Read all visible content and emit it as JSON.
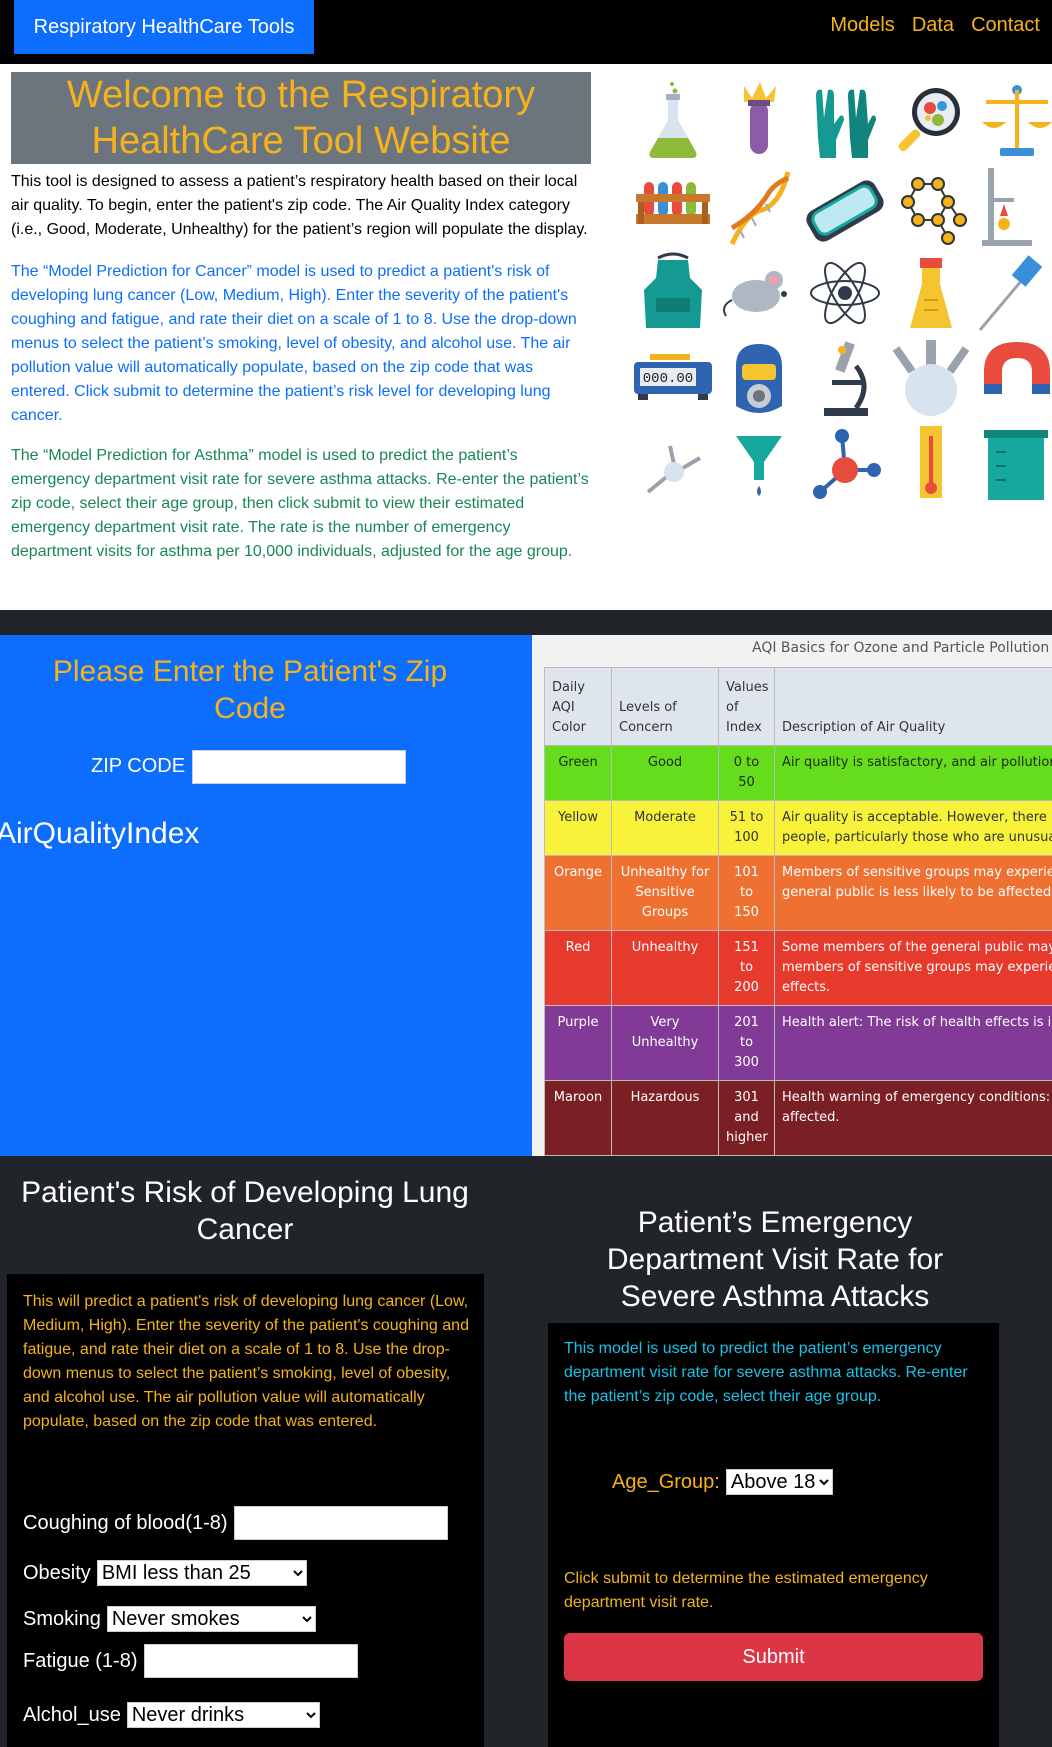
{
  "navbar": {
    "brand": "Respiratory HealthCare Tools",
    "links": [
      "Models",
      "Data",
      "Contact"
    ]
  },
  "intro": {
    "title": "Welcome to the Respiratory HealthCare Tool Website",
    "p1": "This tool is designed to assess a patient’s respiratory health based on their local air quality. To begin, enter the patient's zip code. The Air Quality Index category (i.e., Good, Moderate, Unhealthy) for the patient’s region will populate the display.",
    "p2": "The “Model Prediction for Cancer” model is used to predict a patient's risk of developing lung cancer (Low, Medium, High). Enter the severity of the patient's coughing and fatigue, and rate their diet on a scale of 1 to 8. Use the drop-down menus to select the patient’s smoking, level of obesity, and alcohol use. The air pollution value will automatically populate, based on the zip code that was entered. Click submit to determine the patient’s risk level for developing lung cancer.",
    "p3": "The “Model Prediction for Asthma” model is used to predict the patient’s emergency department visit rate for severe asthma attacks. Re-enter the patient’s zip code, select their age group, then click submit to view their estimated emergency department visit rate. The rate is the number of emergency department visits for asthma per 10,000 individuals, adjusted for the age group.",
    "icons": [
      "flask-icon",
      "test-tube-icon",
      "gloves-icon",
      "magnifier-icon",
      "scale-icon",
      "test-tube-rack-icon",
      "dna-icon",
      "goggles-icon",
      "molecule-ring-icon",
      "lab-stand-icon",
      "apron-icon",
      "mouse-icon",
      "atom-icon",
      "beaker-icon",
      "pipette-icon",
      "digital-scale-icon",
      "hazmat-mask-icon",
      "microscope-icon",
      "round-flask-icon",
      "magnet-icon",
      "dropper-icon",
      "funnel-icon",
      "molecule-icon",
      "thermometer-icon",
      "measuring-cup-icon"
    ]
  },
  "zip": {
    "title": "Please Enter the Patient's Zip Code",
    "label": "ZIP CODE",
    "value": "",
    "aqi_label": "AirQualityIndex"
  },
  "aqi_table": {
    "caption": "AQI Basics for Ozone and Particle Pollution",
    "headers": [
      "Daily AQI Color",
      "Levels of Concern",
      "Values of Index",
      "Description of Air Quality"
    ],
    "rows": [
      {
        "color": "Green",
        "level": "Good",
        "values": "0 to 50",
        "desc": "Air quality is satisfactory, and air pollution",
        "bg": "#66dd1c",
        "fg": "#1f2b10"
      },
      {
        "color": "Yellow",
        "level": "Moderate",
        "values": "51 to 100",
        "desc": "Air quality is acceptable. However, there m people, particularly those who are unusual",
        "bg": "#f8f33a",
        "fg": "#333"
      },
      {
        "color": "Orange",
        "level": "Unhealthy for Sensitive Groups",
        "values": "101 to 150",
        "desc": "Members of sensitive groups may experien general public is less likely to be affected.",
        "bg": "#ef7131",
        "fg": "#fff"
      },
      {
        "color": "Red",
        "level": "Unhealthy",
        "values": "151 to 200",
        "desc": "Some members of the general public may c members of sensitive groups may experien effects.",
        "bg": "#e63a2c",
        "fg": "#fff"
      },
      {
        "color": "Purple",
        "level": "Very Unhealthy",
        "values": "201 to 300",
        "desc": "Health alert: The risk of health effects is inc",
        "bg": "#823a97",
        "fg": "#fff"
      },
      {
        "color": "Maroon",
        "level": "Hazardous",
        "values": "301 and higher",
        "desc": "Health warning of emergency conditions: e be affected.",
        "bg": "#7a1f23",
        "fg": "#fff"
      }
    ]
  },
  "lung": {
    "title": "Patient's Risk of Developing Lung Cancer",
    "desc": "This will predict a patient's risk of developing lung cancer (Low, Medium, High). Enter the severity of the patient's coughing and fatigue, and rate their diet on a scale of 1 to 8. Use the drop-down menus to select the patient’s smoking, level of obesity, and alcohol use. The air pollution value will automatically populate, based on the zip code that was entered.",
    "coughing_label": "Coughing of blood(1-8)",
    "obesity_label": "Obesity",
    "obesity_value": "BMI less than 25",
    "smoking_label": "Smoking",
    "smoking_value": "Never smokes",
    "fatigue_label": "Fatigue (1-8)",
    "alcohol_label": "Alchol_use",
    "alcohol_value": "Never drinks"
  },
  "asthma": {
    "title": "Patient’s Emergency Department Visit Rate for Severe Asthma Attacks",
    "desc": "This model is used to predict the patient’s emergency department visit rate for severe asthma attacks. Re-enter the patient’s zip code, select their age group.",
    "age_label": "Age_Group:",
    "age_value": "Above 18",
    "note": "Click submit to determine the estimated emergency department visit rate.",
    "submit_label": "Submit"
  }
}
